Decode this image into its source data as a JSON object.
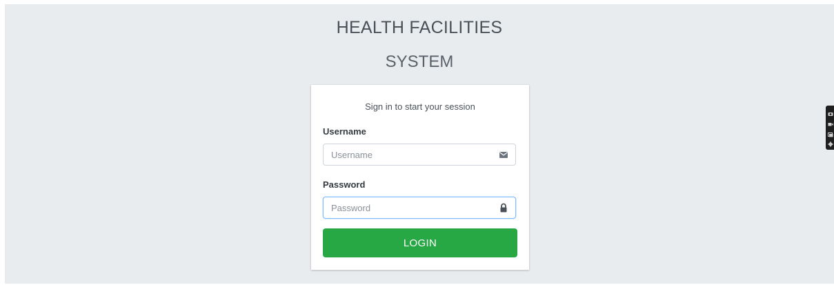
{
  "brand": {
    "line1": "HEALTH FACILITIES",
    "line2": "SYSTEM"
  },
  "login": {
    "message": "Sign in to start your session",
    "username_label": "Username",
    "username_placeholder": "Username",
    "username_value": "",
    "password_label": "Password",
    "password_placeholder": "Password",
    "password_value": "",
    "submit_label": "LOGIN"
  },
  "icons": {
    "username": "envelope-icon",
    "password": "lock-icon",
    "toolbar": [
      "camera-icon",
      "video-icon",
      "screenshot-icon",
      "gear-icon"
    ]
  },
  "colors": {
    "background": "#e9ecef",
    "primary_button": "#28a745",
    "focus_border": "#80bdff"
  }
}
